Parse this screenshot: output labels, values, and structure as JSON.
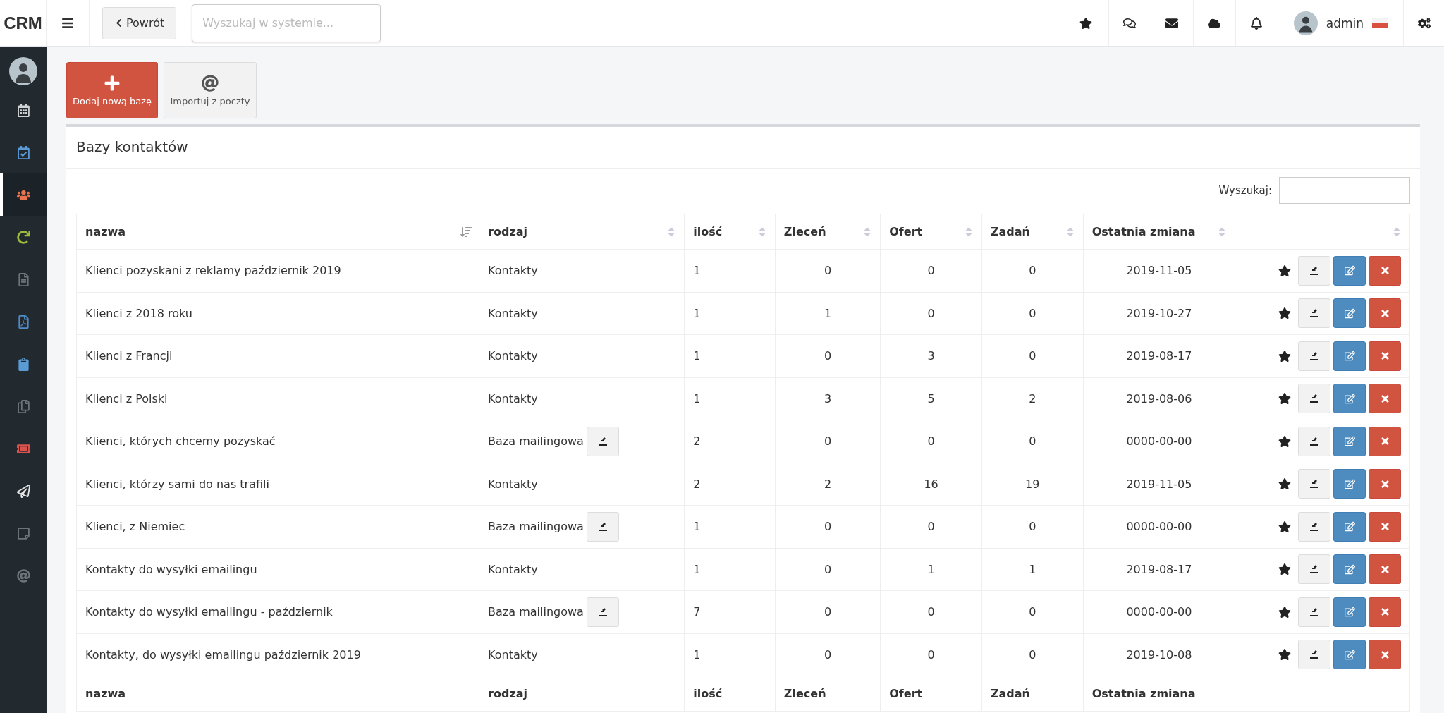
{
  "topbar": {
    "logo": "CRM",
    "back_button": "Powrót",
    "search": {
      "placeholder": "Wyszukaj w systemie..."
    },
    "user": {
      "name": "admin"
    }
  },
  "sidebar": {
    "items": [
      {
        "selected": false,
        "color": "#cfd3d6"
      },
      {
        "selected": false,
        "color": "#5b9bd5"
      },
      {
        "selected": true,
        "color": "#e8744f"
      },
      {
        "selected": false,
        "color": "#9cba3c"
      },
      {
        "selected": false,
        "color": "#6d747a"
      },
      {
        "selected": false,
        "color": "#4f8dc9"
      },
      {
        "selected": false,
        "color": "#5b9bd5"
      },
      {
        "selected": false,
        "color": "#6d747a"
      },
      {
        "selected": false,
        "color": "#d9534f"
      },
      {
        "selected": false,
        "color": "#e6e6e6"
      },
      {
        "selected": false,
        "color": "#6d747a"
      },
      {
        "selected": false,
        "color": "#6d747a"
      }
    ]
  },
  "actions": [
    {
      "kind": "primary",
      "label": "Dodaj nową bazę"
    },
    {
      "kind": "default",
      "label": "Importuj z poczty"
    }
  ],
  "panel": {
    "title": "Bazy kontaktów",
    "search_label": "Wyszukaj:"
  },
  "table": {
    "columns": [
      {
        "label": "nazwa",
        "sorted": true
      },
      {
        "label": "rodzaj",
        "sorted": false
      },
      {
        "label": "ilość",
        "sorted": false
      },
      {
        "label": "Zleceń",
        "sorted": false
      },
      {
        "label": "Ofert",
        "sorted": false
      },
      {
        "label": "Zadań",
        "sorted": false
      },
      {
        "label": "Ostatnia zmiana",
        "sorted": false
      },
      {
        "sorted": false
      }
    ],
    "rows": [
      {
        "name": "Klienci pozyskani z reklamy październik 2019",
        "type": "Kontakty",
        "import_button": false,
        "count": "1",
        "orders": "0",
        "offers": "0",
        "tasks": "0",
        "changed": "2019-11-05"
      },
      {
        "name": "Klienci z 2018 roku",
        "type": "Kontakty",
        "import_button": false,
        "count": "1",
        "orders": "1",
        "offers": "0",
        "tasks": "0",
        "changed": "2019-10-27"
      },
      {
        "name": "Klienci z Francji",
        "type": "Kontakty",
        "import_button": false,
        "count": "1",
        "orders": "0",
        "offers": "3",
        "tasks": "0",
        "changed": "2019-08-17"
      },
      {
        "name": "Klienci z Polski",
        "type": "Kontakty",
        "import_button": false,
        "count": "1",
        "orders": "3",
        "offers": "5",
        "tasks": "2",
        "changed": "2019-08-06"
      },
      {
        "name": "Klienci, których chcemy pozyskać",
        "type": "Baza mailingowa",
        "import_button": true,
        "count": "2",
        "orders": "0",
        "offers": "0",
        "tasks": "0",
        "changed": "0000-00-00"
      },
      {
        "name": "Klienci, którzy sami do nas trafili",
        "type": "Kontakty",
        "import_button": false,
        "count": "2",
        "orders": "2",
        "offers": "16",
        "tasks": "19",
        "changed": "2019-11-05"
      },
      {
        "name": "Klienci, z Niemiec",
        "type": "Baza mailingowa",
        "import_button": true,
        "count": "1",
        "orders": "0",
        "offers": "0",
        "tasks": "0",
        "changed": "0000-00-00"
      },
      {
        "name": "Kontakty do wysyłki emailingu",
        "type": "Kontakty",
        "import_button": false,
        "count": "1",
        "orders": "0",
        "offers": "1",
        "tasks": "1",
        "changed": "2019-08-17"
      },
      {
        "name": "Kontakty do wysyłki emailingu - październik",
        "type": "Baza mailingowa",
        "import_button": true,
        "count": "7",
        "orders": "0",
        "offers": "0",
        "tasks": "0",
        "changed": "0000-00-00"
      },
      {
        "name": "Kontakty, do wysyłki emailingu październik 2019",
        "type": "Kontakty",
        "import_button": false,
        "count": "1",
        "orders": "0",
        "offers": "0",
        "tasks": "0",
        "changed": "2019-10-08"
      }
    ],
    "footer": [
      "nazwa",
      "rodzaj",
      "ilość",
      "Zleceń",
      "Ofert",
      "Zadań",
      "Ostatnia zmiana"
    ]
  }
}
